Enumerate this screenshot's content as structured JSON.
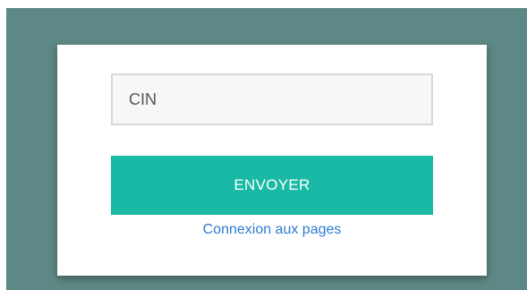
{
  "form": {
    "cin_placeholder": "CIN",
    "cin_value": "",
    "submit_label": "ENVOYER",
    "pages_link_label": "Connexion aux pages"
  },
  "colors": {
    "backdrop": "#5e8885",
    "card": "#ffffff",
    "button": "#1ab9a5",
    "link": "#2f7bd0"
  }
}
